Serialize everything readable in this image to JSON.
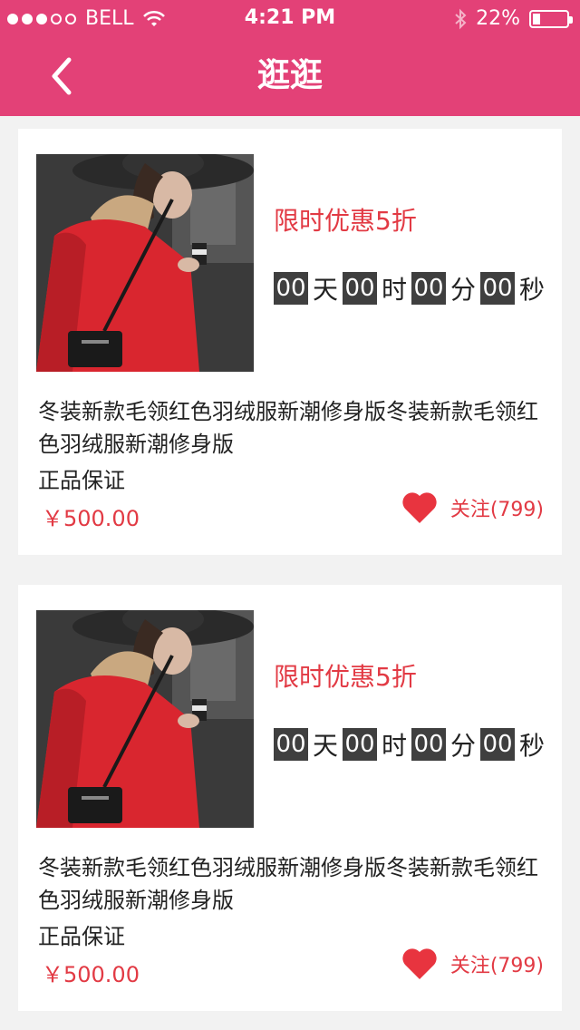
{
  "status_bar": {
    "carrier": "BELL",
    "time": "4:21 PM",
    "battery": "22%",
    "battery_level": 0.22
  },
  "nav": {
    "title": "逛逛"
  },
  "products": [
    {
      "promo": "限时优惠5折",
      "countdown": {
        "days": "00",
        "days_unit": "天",
        "hours": "00",
        "hours_unit": "时",
        "minutes": "00",
        "minutes_unit": "分",
        "seconds": "00",
        "seconds_unit": "秒"
      },
      "description": "冬装新款毛领红色羽绒服新潮修身版冬装新款毛领红色羽绒服新潮修身版",
      "guarantee": "正品保证",
      "price": "￥500.00",
      "follow": "关注(799)"
    },
    {
      "promo": "限时优惠5折",
      "countdown": {
        "days": "00",
        "days_unit": "天",
        "hours": "00",
        "hours_unit": "时",
        "minutes": "00",
        "minutes_unit": "分",
        "seconds": "00",
        "seconds_unit": "秒"
      },
      "description": "冬装新款毛领红色羽绒服新潮修身版冬装新款毛领红色羽绒服新潮修身版",
      "guarantee": "正品保证",
      "price": "￥500.00",
      "follow": "关注(799)"
    }
  ],
  "colors": {
    "header": "#e34177",
    "accent": "#e23a44",
    "timer_box": "#3f3f3f"
  }
}
